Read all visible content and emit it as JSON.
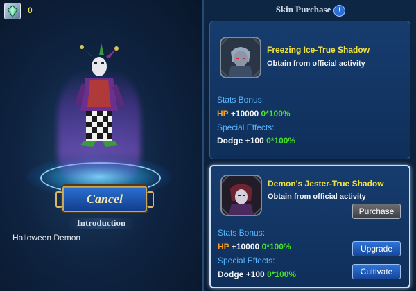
{
  "currency": {
    "value": "0",
    "icon": "gem-icon"
  },
  "left": {
    "cancel_label": "Cancel",
    "intro_title": "Introduction",
    "intro_text": "Halloween Demon"
  },
  "right": {
    "title": "Skin Purchase",
    "info_icon": "!",
    "skins": [
      {
        "name": "Freezing Ice-True Shadow",
        "source": "Obtain from official activity",
        "stats_label": "Stats Bonus:",
        "hp_label": "HP",
        "hp_value": "+10000",
        "hp_growth": "0*100%",
        "effects_label": "Special Effects:",
        "dodge_label": "Dodge",
        "dodge_value": "+100",
        "dodge_growth": "0*100%"
      },
      {
        "name": "Demon's Jester-True Shadow",
        "source": "Obtain from official activity",
        "stats_label": "Stats Bonus:",
        "hp_label": "HP",
        "hp_value": "+10000",
        "hp_growth": "0*100%",
        "effects_label": "Special Effects:",
        "dodge_label": "Dodge",
        "dodge_value": "+100",
        "dodge_growth": "0*100%",
        "purchase_label": "Purchase",
        "upgrade_label": "Upgrade",
        "cultivate_label": "Cultivate"
      }
    ]
  },
  "colors": {
    "name_yellow": "#f2e23b",
    "stat_blue": "#5ab6ff",
    "hp_orange": "#ff9c1c",
    "growth_green": "#48e02a"
  }
}
